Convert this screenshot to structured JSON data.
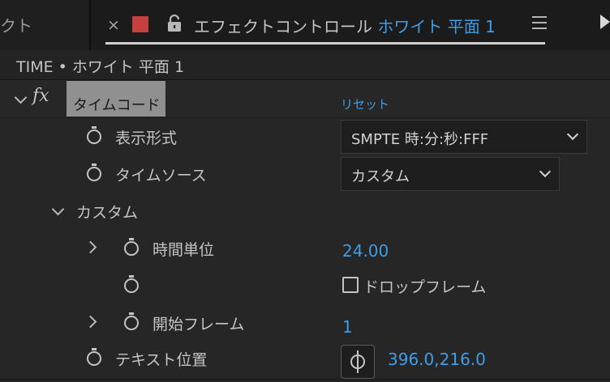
{
  "tabs": {
    "left_tab_label": "クト",
    "active_tab": {
      "close_symbol": "×",
      "label_color": "#c8403d",
      "title_prefix": "エフェクトコントロール",
      "layer_name": "ホワイト 平面 1",
      "menu_icon": "hamburger-menu-icon",
      "lock_icon": "lock-open-icon"
    }
  },
  "breadcrumb": "TIME • ホワイト 平面 1",
  "effect": {
    "fx_symbol": "fx",
    "name": "タイムコード",
    "reset_label": "リセット",
    "properties": [
      {
        "label": "表示形式",
        "type": "dropdown",
        "value": "SMPTE 時:分:秒:FFF"
      },
      {
        "label": "タイムソース",
        "type": "dropdown",
        "value": "カスタム"
      }
    ],
    "group": {
      "label": "カスタム",
      "properties": [
        {
          "label": "時間単位",
          "type": "number",
          "value": "24.00"
        },
        {
          "label": "",
          "type": "checkbox",
          "value": "ドロップフレーム",
          "checked": false
        },
        {
          "label": "開始フレーム",
          "type": "number",
          "value": "1"
        }
      ]
    },
    "last_property": {
      "label": "テキスト位置",
      "value": "396.0,216.0"
    }
  },
  "colors": {
    "accent": "#3d9de8",
    "panel_bg": "#232323",
    "selected_name_bg": "#909090"
  }
}
